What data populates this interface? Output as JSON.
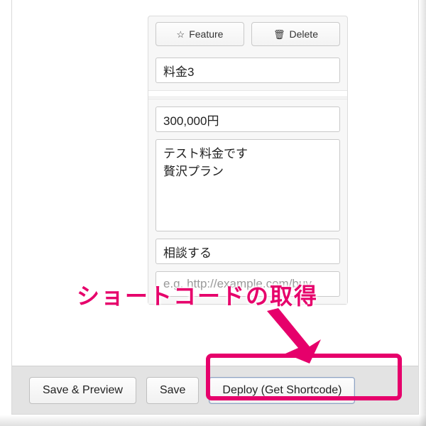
{
  "card": {
    "feature_label": "Feature",
    "delete_label": "Delete",
    "title_value": "料金3",
    "price_value": "300,000円",
    "description_value": "テスト料金です\n贅沢プラン",
    "cta_value": "相談する",
    "url_placeholder": "e.g. http://example.com/buy"
  },
  "footer": {
    "save_preview_label": "Save & Preview",
    "save_label": "Save",
    "deploy_label": "Deploy (Get Shortcode)"
  },
  "annotation": {
    "callout_text": "ショートコードの取得"
  },
  "icons": {
    "star": "☆",
    "trash": "🗑"
  },
  "colors": {
    "accent_pink": "#e6006b"
  }
}
